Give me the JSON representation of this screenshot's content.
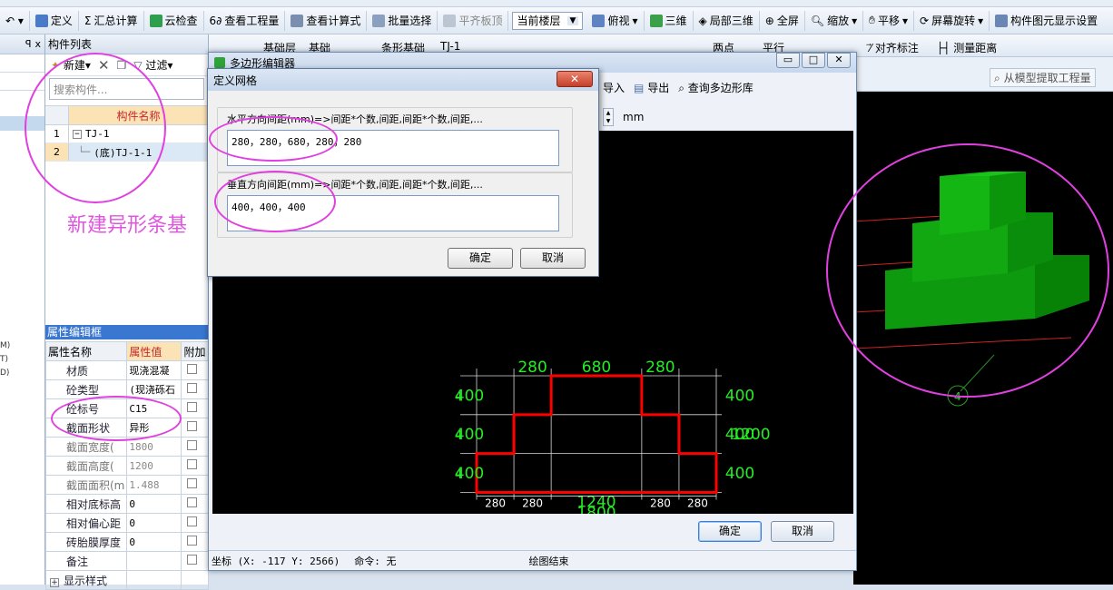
{
  "toolbar": {
    "define": "定义",
    "sum_calc": "汇总计算",
    "cloud_check": "云检查",
    "view_qty": "查看工程量",
    "view_formula": "查看计算式",
    "batch_select": "批量选择",
    "flat_slab": "平齐板顶",
    "current_floor": "当前楼层",
    "top_view": "俯视",
    "three_d": "三维",
    "local_3d": "局部三维",
    "full_screen": "全屏",
    "zoom": "缩放",
    "pan": "平移",
    "rotate": "屏幕旋转",
    "display_settings": "构件图元显示设置"
  },
  "left_strip": {
    "close_mark": "x",
    "labels": [
      "M)",
      "T)",
      "D)"
    ]
  },
  "component_list": {
    "title": "构件列表",
    "new_label": "新建",
    "filter_label": "过滤",
    "search_placeholder": "搜索构件...",
    "col_name": "构件名称",
    "rows": [
      {
        "num": "1",
        "label": "TJ-1",
        "expander": "−"
      },
      {
        "num": "2",
        "label": "(底)TJ-1-1"
      }
    ]
  },
  "annotation_text": "新建异形条基",
  "properties": {
    "title": "属性编辑框",
    "col_name": "属性名称",
    "col_value": "属性值",
    "col_extra": "附加",
    "rows": [
      {
        "name": "材质",
        "value": "现浇混凝"
      },
      {
        "name": "砼类型",
        "value": "(现浇砾石"
      },
      {
        "name": "砼标号",
        "value": "C15"
      },
      {
        "name": "截面形状",
        "value": "异形"
      },
      {
        "name": "截面宽度(",
        "value": "1800",
        "muted": true
      },
      {
        "name": "截面高度(",
        "value": "1200",
        "muted": true
      },
      {
        "name": "截面面积(m",
        "value": "1.488",
        "muted": true
      },
      {
        "name": "相对底标高",
        "value": "0"
      },
      {
        "name": "相对偏心距",
        "value": "0"
      },
      {
        "name": "砖胎膜厚度",
        "value": "0"
      },
      {
        "name": "备注",
        "value": ""
      },
      {
        "name": "显示样式",
        "value": "",
        "group": true
      }
    ]
  },
  "bg_toolbar": {
    "item1": "基础层",
    "item2": "基础",
    "item3": "条形基础",
    "item4": "TJ-1",
    "point": "两点",
    "parallel": "平行",
    "align_mark": "对齐标注",
    "measure": "测量距离",
    "extract": "从模型提取工程量"
  },
  "poly_dialog": {
    "title": "多边形编辑器",
    "import": "导入",
    "export": "导出",
    "query_lib": "查询多边形库",
    "unit": "mm",
    "ok": "确定",
    "cancel": "取消",
    "status_coord": "坐标 (X: -117 Y: 2566)",
    "status_cmd": "命令: 无",
    "status_draw": "绘图结束"
  },
  "drawing": {
    "top_dims": [
      "280",
      "680",
      "280"
    ],
    "right_dims": [
      "400",
      "400",
      "400"
    ],
    "right_total": "1200",
    "left_dims": [
      "400",
      "400",
      "400"
    ],
    "left_prefix": "4",
    "bottom_inner": [
      "280",
      "280",
      "1240",
      "280",
      "280"
    ],
    "bottom_total": "1800",
    "grid_num": "4"
  },
  "grid_dialog": {
    "title": "定义网格",
    "h_label": "水平方向间距(mm)=>间距*个数,间距,间距*个数,间距,...",
    "h_value": "280，280，680，280，280",
    "v_label": "垂直方向间距(mm)=>间距*个数,间距,间距*个数,间距,...",
    "v_value": "400，400，400",
    "ok": "确定",
    "cancel": "取消"
  },
  "colors": {
    "polygon": "#ff0000",
    "dims": "#22ee22",
    "solid": "#0d8f0d",
    "annotation": "#e040e0"
  }
}
